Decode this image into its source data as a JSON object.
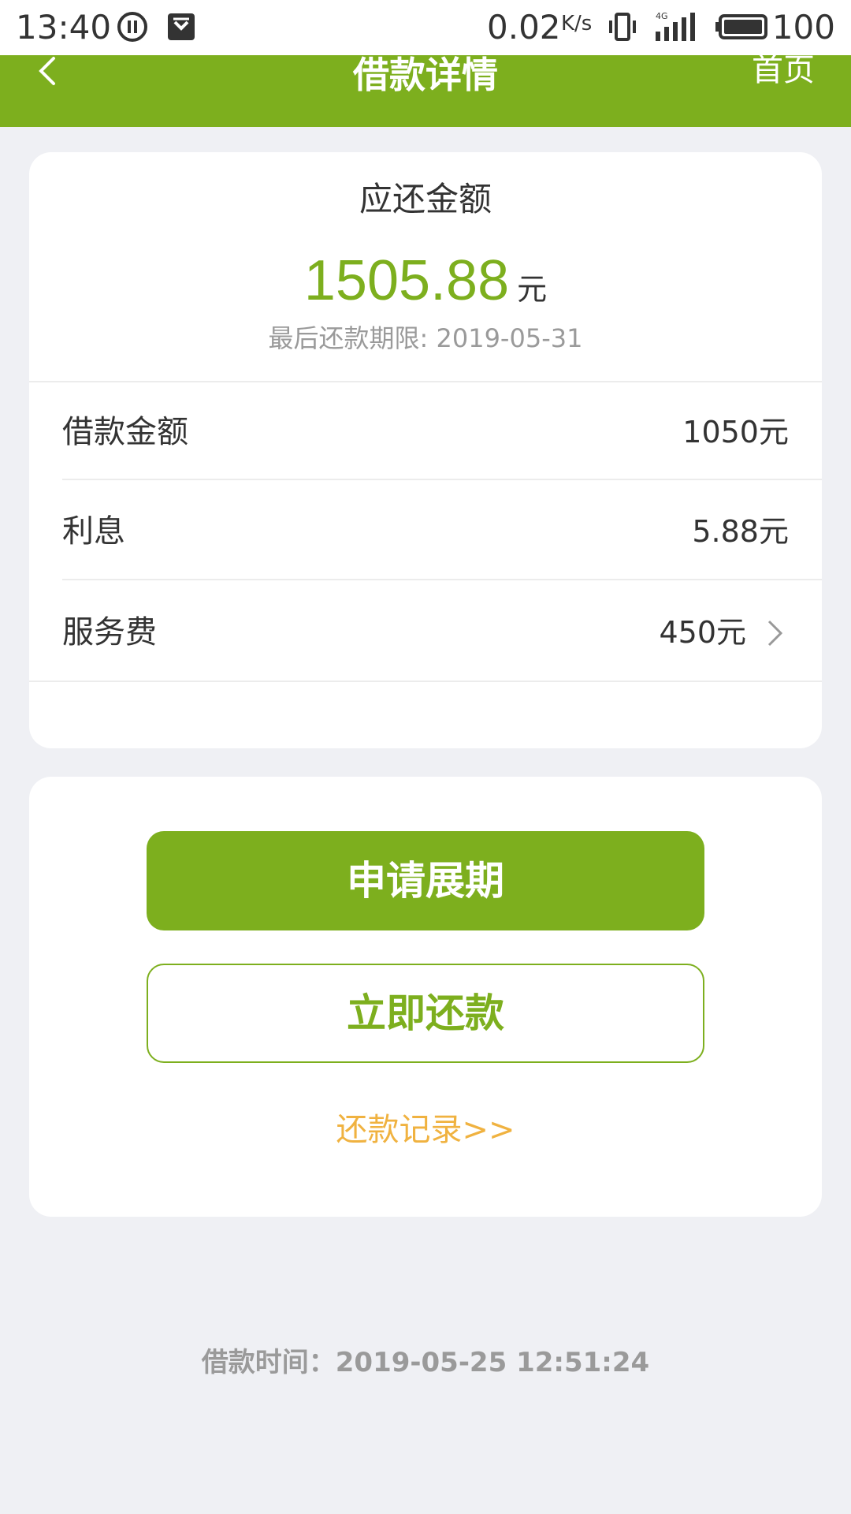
{
  "status_bar": {
    "time": "13:40",
    "network_speed": "0.02",
    "network_speed_unit": "K/s",
    "network_type": "4G",
    "battery": "100",
    "icons": [
      "pause-circle-icon",
      "shield-icon",
      "vibrate-icon",
      "signal-icon",
      "battery-icon"
    ]
  },
  "nav": {
    "title": "借款详情",
    "home_label": "首页",
    "back_icon": "chevron-left-icon"
  },
  "summary": {
    "title": "应还金额",
    "amount": "1505.88",
    "unit": "元",
    "deadline": "最后还款期限: 2019-05-31"
  },
  "details": [
    {
      "label": "借款金额",
      "value": "1050元"
    },
    {
      "label": "利息",
      "value": "5.88元"
    },
    {
      "label": "服务费",
      "value": "450元"
    }
  ],
  "actions": {
    "apply_extension": "申请展期",
    "repay_now": "立即还款",
    "repay_record": "还款记录>>"
  },
  "footer": {
    "loan_time": "借款时间：2019-05-25 12:51:24"
  },
  "colors": {
    "brand_green": "#7daf1e",
    "link_orange": "#f0b240",
    "background": "#eff0f4"
  }
}
